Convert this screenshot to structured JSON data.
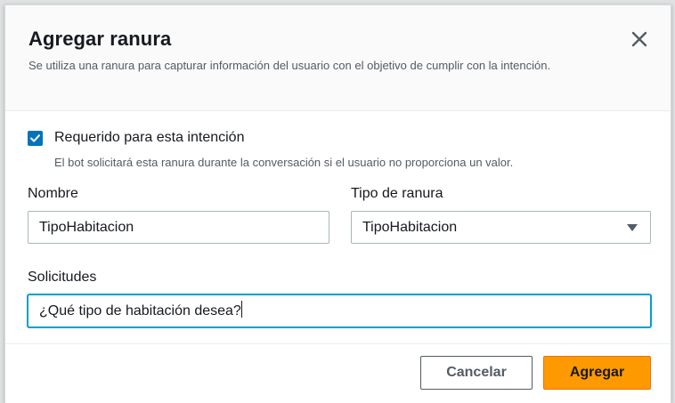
{
  "dialog": {
    "title": "Agregar ranura",
    "subtitle": "Se utiliza una ranura para capturar información del usuario con el objetivo de cumplir con la intención."
  },
  "required": {
    "checked": true,
    "label": "Requerido para esta intención",
    "description": "El bot solicitará esta ranura durante la conversación si el usuario no proporciona un valor."
  },
  "name_field": {
    "label": "Nombre",
    "value": "TipoHabitacion"
  },
  "slot_type_field": {
    "label": "Tipo de ranura",
    "selected": "TipoHabitacion"
  },
  "prompts_field": {
    "label": "Solicitudes",
    "value": "¿Qué tipo de habitación desea?"
  },
  "footer": {
    "cancel_label": "Cancelar",
    "add_label": "Agregar"
  },
  "colors": {
    "primary_button": "#ff9900",
    "checkbox": "#0073bb",
    "focus_border": "#00a1c9"
  }
}
